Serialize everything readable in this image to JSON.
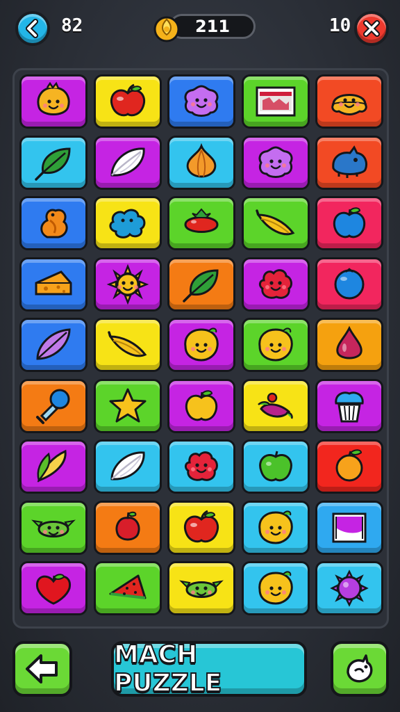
{
  "header": {
    "moves_left": "82",
    "coins": "211",
    "level": "10"
  },
  "footer": {
    "main_button_label": "MACH PUZZLE"
  },
  "board": {
    "rows": 9,
    "cols": 5,
    "tiles": [
      [
        {
          "bg": "#c524e3",
          "icon": "chick-icon"
        },
        {
          "bg": "#f7e316",
          "icon": "apple-icon"
        },
        {
          "bg": "#2f7bf0",
          "icon": "flower-blob-icon"
        },
        {
          "bg": "#5cd42a",
          "icon": "picture-frame-icon"
        },
        {
          "bg": "#f24a24",
          "icon": "smiling-dumpling-icon"
        }
      ],
      [
        {
          "bg": "#33c4ee",
          "icon": "leaf-icon"
        },
        {
          "bg": "#c524e3",
          "icon": "feather-icon"
        },
        {
          "bg": "#33c4ee",
          "icon": "garlic-icon"
        },
        {
          "bg": "#c524e3",
          "icon": "flower-blob-icon"
        },
        {
          "bg": "#f24a24",
          "icon": "hippo-icon"
        }
      ],
      [
        {
          "bg": "#2f7bf0",
          "icon": "squirrel-icon"
        },
        {
          "bg": "#f7e316",
          "icon": "splat-icon"
        },
        {
          "bg": "#5cd42a",
          "icon": "tomato-icon"
        },
        {
          "bg": "#5cd42a",
          "icon": "banana-icon"
        },
        {
          "bg": "#f2265e",
          "icon": "blue-apple-icon"
        }
      ],
      [
        {
          "bg": "#2f7bf0",
          "icon": "cheese-icon"
        },
        {
          "bg": "#c524e3",
          "icon": "sun-face-icon"
        },
        {
          "bg": "#f47b14",
          "icon": "leaf-icon"
        },
        {
          "bg": "#c524e3",
          "icon": "red-blob-icon"
        },
        {
          "bg": "#f2265e",
          "icon": "blue-berry-icon"
        }
      ],
      [
        {
          "bg": "#2f7bf0",
          "icon": "purple-leaf-icon"
        },
        {
          "bg": "#f7e316",
          "icon": "banana-icon"
        },
        {
          "bg": "#c524e3",
          "icon": "yellow-face-icon"
        },
        {
          "bg": "#5cd42a",
          "icon": "yellow-face-icon"
        },
        {
          "bg": "#f5a10f",
          "icon": "drop-icon"
        }
      ],
      [
        {
          "bg": "#f47b14",
          "icon": "pacifier-icon"
        },
        {
          "bg": "#5cd42a",
          "icon": "star-icon"
        },
        {
          "bg": "#c524e3",
          "icon": "yellow-apple-icon"
        },
        {
          "bg": "#f7e316",
          "icon": "beet-icon"
        },
        {
          "bg": "#c524e3",
          "icon": "cupcake-icon"
        }
      ],
      [
        {
          "bg": "#c524e3",
          "icon": "corn-icon"
        },
        {
          "bg": "#33c4ee",
          "icon": "feather-icon"
        },
        {
          "bg": "#33c4ee",
          "icon": "red-blob-icon"
        },
        {
          "bg": "#33c4ee",
          "icon": "green-apple-icon"
        },
        {
          "bg": "#f2261e",
          "icon": "orange-icon"
        }
      ],
      [
        {
          "bg": "#5cd42a",
          "icon": "green-face-icon"
        },
        {
          "bg": "#f47b14",
          "icon": "cherry-icon"
        },
        {
          "bg": "#f7e316",
          "icon": "apple-icon"
        },
        {
          "bg": "#33c4ee",
          "icon": "yellow-face-icon"
        },
        {
          "bg": "#2fa9f0",
          "icon": "banner-icon"
        }
      ],
      [
        {
          "bg": "#c524e3",
          "icon": "heart-apple-icon"
        },
        {
          "bg": "#5cd42a",
          "icon": "watermelon-icon"
        },
        {
          "bg": "#f7e316",
          "icon": "green-face-icon"
        },
        {
          "bg": "#33c4ee",
          "icon": "yellow-face-icon"
        },
        {
          "bg": "#33c4ee",
          "icon": "gear-flower-icon"
        }
      ]
    ]
  }
}
